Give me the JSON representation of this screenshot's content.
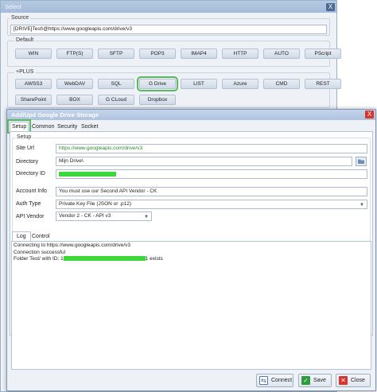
{
  "select_window": {
    "title": "Select",
    "close_label": "X",
    "source": {
      "label": "Source",
      "value": "[DRIVE]Test\\@https://www.googleapis.com/drive/v3"
    },
    "default": {
      "label": "Default",
      "buttons": [
        "WIN",
        "FTP(S)",
        "SFTP",
        "POP3",
        "IMAP4",
        "HTTP",
        "AUTO",
        "PScript"
      ]
    },
    "plus": {
      "label": "+PLUS",
      "buttons": [
        "AWSS3",
        "WebDAV",
        "SQL",
        "G Drive",
        "LIST",
        "Azure",
        "CMD",
        "REST",
        "SharePoint",
        "BOX",
        "G CLoud",
        "Dropbox"
      ],
      "selected": "G Drive"
    }
  },
  "gdrive_window": {
    "title": "Add/Upd Google Drive Storage",
    "close_label": "X",
    "tabs": [
      "Setup",
      "Common",
      "Security",
      "Socket"
    ],
    "active_tab": "Setup",
    "setup_group_label": "Setup",
    "fields": {
      "site_url": {
        "label": "Site Url",
        "value": "https://www.googleapis.com/drive/v3"
      },
      "directory": {
        "label": "Directory",
        "value": "Mijn Drive\\"
      },
      "directory_id": {
        "label": "Directory ID",
        "value": ""
      },
      "account_info": {
        "label": "Account Info",
        "value": "You must use our Second API Vendor - CK"
      },
      "auth_type": {
        "label": "Auth Type",
        "value": "Private Key File (JSON or .p12)"
      },
      "api_vendor": {
        "label": "API Vendor",
        "value": "Vendor 2 - CK - API v3"
      }
    },
    "bottom_tabs": [
      "Log",
      "Control"
    ],
    "active_bottom_tab": "Log",
    "log_lines": [
      "Connecting to https://www.googleapis.com/drive/v3",
      "Connection successful"
    ],
    "log_folder_prefix": "Folder Test/ with ID: 1",
    "log_folder_suffix": "1 exists",
    "buttons": {
      "connect": "Connect",
      "save": "Save",
      "close": "Close"
    },
    "colors": {
      "highlight": "#5cb85c",
      "redacted": "#3bd83b",
      "close_red": "#d9342b"
    }
  }
}
